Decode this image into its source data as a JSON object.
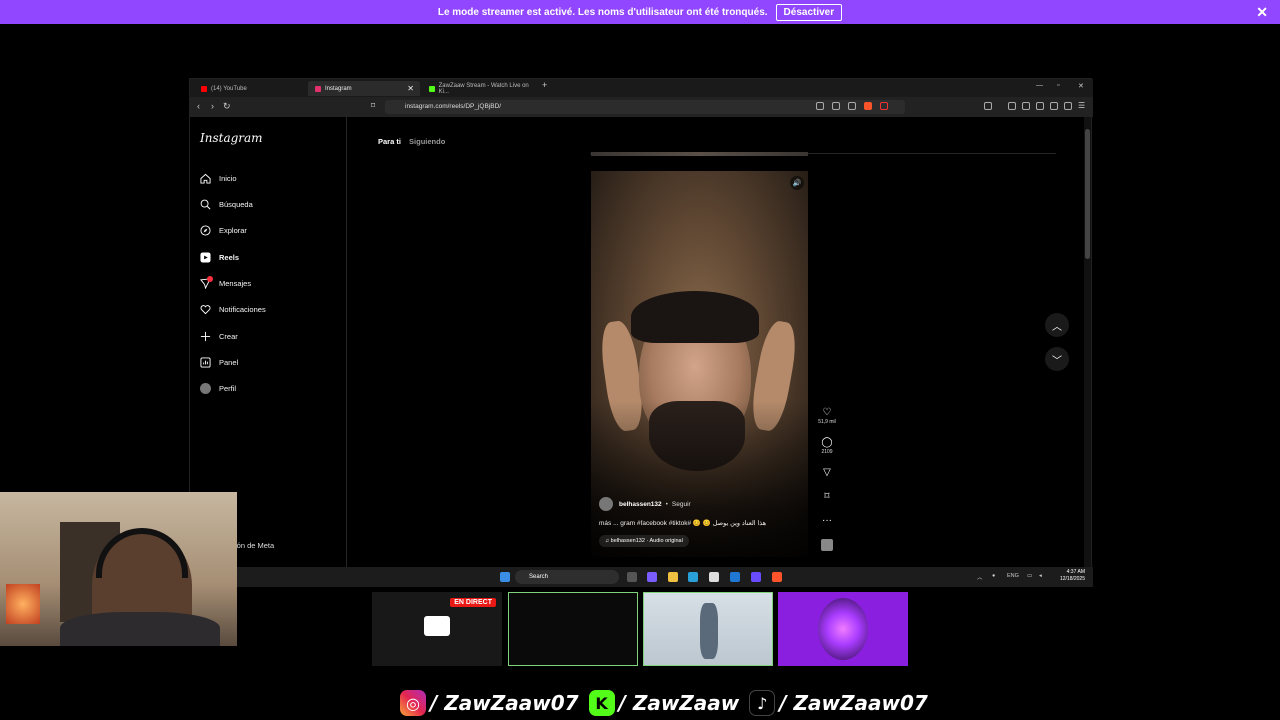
{
  "banner": {
    "message": "Le mode streamer est activé. Les noms d'utilisateur ont été tronqués.",
    "button": "Désactiver",
    "close_icon": "close-icon"
  },
  "browser": {
    "tabs": [
      {
        "label": "(14) YouTube",
        "color": "#ff0000"
      },
      {
        "label": "Instagram",
        "color": "#e1306c",
        "active": true
      },
      {
        "label": "ZawZaaw Stream - Watch Live on Ki...",
        "color": "#53fc18"
      }
    ],
    "new_tab": "+",
    "url": "instagram.com/reels/DP_jQBjBD/"
  },
  "instagram": {
    "logo": "Instagram",
    "nav": [
      {
        "label": "Inicio",
        "icon": "home-icon"
      },
      {
        "label": "Búsqueda",
        "icon": "search-icon"
      },
      {
        "label": "Explorar",
        "icon": "compass-icon"
      },
      {
        "label": "Reels",
        "icon": "reels-icon",
        "active": true
      },
      {
        "label": "Mensajes",
        "icon": "messenger-icon",
        "badge": true
      },
      {
        "label": "Notificaciones",
        "icon": "heart-icon"
      },
      {
        "label": "Crear",
        "icon": "plus-icon"
      },
      {
        "label": "Panel",
        "icon": "dashboard-icon"
      },
      {
        "label": "Perfil",
        "icon": "avatar-icon"
      }
    ],
    "meta_footer": "ión de Meta",
    "feed_tabs": {
      "for_you": "Para ti",
      "following": "Siguiendo"
    },
    "reel": {
      "author": "belhassen132",
      "dot": "•",
      "follow": "Seguir",
      "caption": "más ... gram #facebook #tiktok# 😊 😊 هذا العناد وين يوصل",
      "audio": "♫ belhassen132 · Audio original",
      "likes": "51,9 mil",
      "comments": "2109"
    }
  },
  "taskbar": {
    "search": "Search",
    "lang": "ENG",
    "time": "4:37 AM",
    "date": "12/18/2025"
  },
  "stream": {
    "live_badge": "EN DIRECT",
    "socials": [
      {
        "platform": "instagram",
        "handle": "/ ZawZaaw07"
      },
      {
        "platform": "kick",
        "handle": "/ ZawZaaw"
      },
      {
        "platform": "tiktok",
        "handle": "/ ZawZaaw07"
      }
    ]
  }
}
